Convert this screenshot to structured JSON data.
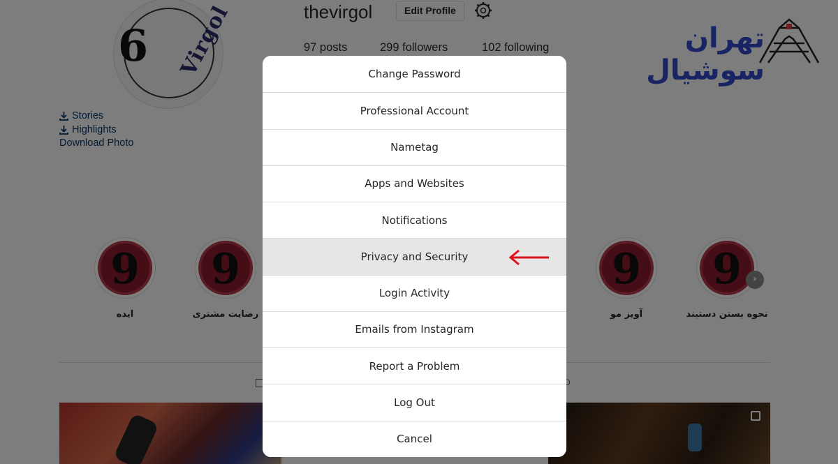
{
  "profile": {
    "username": "thevirgol",
    "edit_profile_label": "Edit Profile",
    "settings_icon": "gear-icon",
    "stats": [
      {
        "label": "97 posts"
      },
      {
        "label": "299 followers"
      },
      {
        "label": "102 following"
      }
    ],
    "avatar_digit": "6",
    "avatar_word": "Virgol"
  },
  "download_links": [
    {
      "label": "Stories",
      "icon": "download-icon"
    },
    {
      "label": "Highlights",
      "icon": "download-icon"
    },
    {
      "label": "Download Photo",
      "icon": ""
    }
  ],
  "brand": {
    "text": "تهران سوشیال",
    "icon": "azadi-tower-icon",
    "color": "#3049c9"
  },
  "highlights": [
    {
      "label": "ایده"
    },
    {
      "label": "رضایت مشتری"
    },
    {
      "label": "آویز مو"
    },
    {
      "label": "نحوه بستن دستبند"
    }
  ],
  "highlight_comma": "9",
  "next_arrow": "›",
  "tabs": {
    "tagged_fragment": "D"
  },
  "modal": {
    "items": [
      {
        "label": "Change Password"
      },
      {
        "label": "Professional Account"
      },
      {
        "label": "Nametag"
      },
      {
        "label": "Apps and Websites"
      },
      {
        "label": "Notifications"
      },
      {
        "label": "Privacy and Security"
      },
      {
        "label": "Login Activity"
      },
      {
        "label": "Emails from Instagram"
      },
      {
        "label": "Report a Problem"
      },
      {
        "label": "Log Out"
      },
      {
        "label": "Cancel"
      }
    ],
    "highlighted_item": "Privacy and Security",
    "annotation_color": "#e0101a"
  },
  "colors": {
    "overlay": "rgba(0,0,0,0.5)",
    "link": "#00376b",
    "highlight_ring": "#8a1b2a"
  }
}
